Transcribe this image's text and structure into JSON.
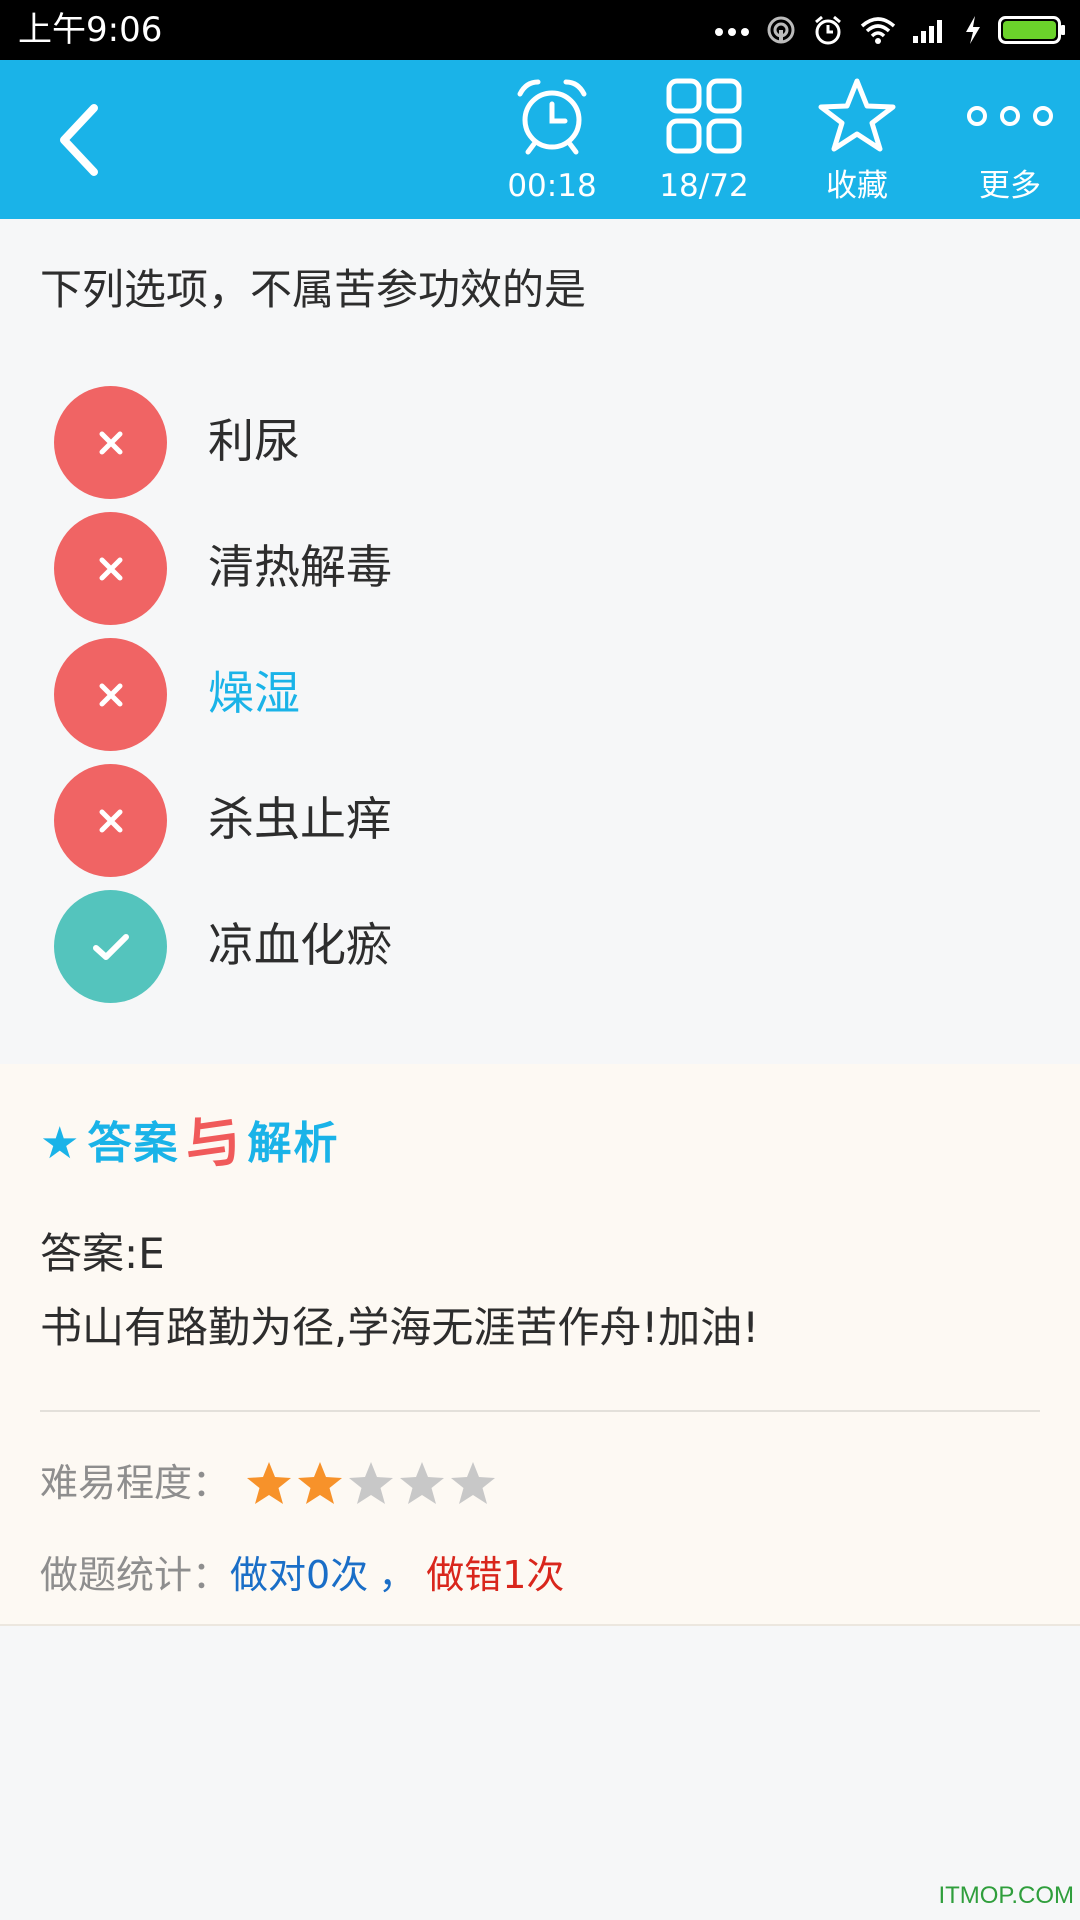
{
  "status_bar": {
    "time": "上午9:06",
    "battery_color": "#6bd22b"
  },
  "toolbar": {
    "back_icon": "chevron-left-icon",
    "timer_label": "00:18",
    "progress_label": "18/72",
    "favorite_label": "收藏",
    "more_label": "更多",
    "background": "#1ab3e8"
  },
  "question": {
    "text": "下列选项，不属苦参功效的是",
    "options": [
      {
        "label": "利尿",
        "status": "wrong",
        "icon": "close-icon"
      },
      {
        "label": "清热解毒",
        "status": "wrong",
        "icon": "close-icon"
      },
      {
        "label": "燥湿",
        "status": "wrong",
        "icon": "close-icon",
        "selected": true
      },
      {
        "label": "杀虫止痒",
        "status": "wrong",
        "icon": "close-icon"
      },
      {
        "label": "凉血化瘀",
        "status": "correct",
        "icon": "check-icon"
      }
    ]
  },
  "analysis": {
    "heading_part1": "答案",
    "heading_part2": "与",
    "heading_part3": "解析",
    "answer": "答案:E",
    "comment": "书山有路勤为径,学海无涯苦作舟!加油!",
    "difficulty_label": "难易程度：",
    "difficulty_rating": 2,
    "difficulty_max": 5,
    "stats_label": "做题统计：",
    "stats_right": "做对0次",
    "stats_sep": "，",
    "stats_wrong": "做错1次"
  },
  "watermark": "ITMOP.COM"
}
